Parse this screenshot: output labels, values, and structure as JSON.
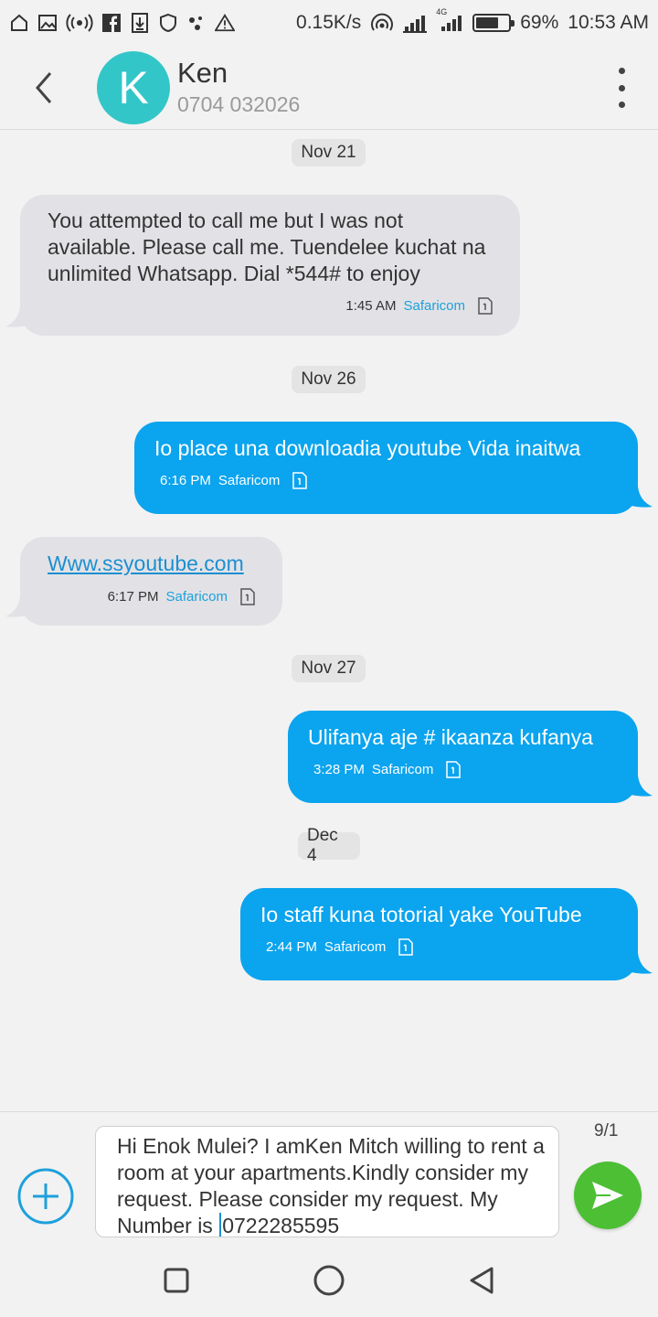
{
  "status_bar": {
    "speed": "0.15K/s",
    "network_badge": "4G",
    "battery": "69%",
    "battery_level": 0.69,
    "time": "10:53 AM",
    "icons": [
      "home-icon",
      "image-icon",
      "radio-icon",
      "facebook-icon",
      "download-icon",
      "shield-icon",
      "dots-icon",
      "warning-icon"
    ]
  },
  "header": {
    "avatar_letter": "K",
    "avatar_color": "#33c6c9",
    "name": "Ken",
    "number": "0704 032026"
  },
  "conversation": {
    "dates": [
      "Nov 21",
      "Nov 26",
      "Nov 27",
      "Dec 4"
    ],
    "messages": [
      {
        "direction": "in",
        "text": "You attempted to call me but I was not available. Please call me. Tuendelee kuchat na unlimited Whatsapp. Dial *544# to enjoy",
        "time": "1:45 AM",
        "carrier": "Safaricom"
      },
      {
        "direction": "out",
        "text": "Io place una downloadia youtube Vida inaitwa",
        "time": "6:16 PM",
        "carrier": "Safaricom"
      },
      {
        "direction": "in",
        "text": "Www.ssyoutube.com",
        "time": "6:17 PM",
        "carrier": "Safaricom"
      },
      {
        "direction": "out",
        "text": "Ulifanya aje # ikaanza kufanya",
        "time": "3:28 PM",
        "carrier": "Safaricom"
      },
      {
        "direction": "out",
        "text": "Io staff kuna totorial yake YouTube",
        "time": "2:44 PM",
        "carrier": "Safaricom"
      }
    ]
  },
  "composer": {
    "draft_before_cursor": "Hi Enok Mulei? I amKen Mitch willing to rent a room at your apartments.Kindly consider my request. Please consider my request.  My Number is ",
    "draft_after_cursor": "0722285595",
    "counter": "9/1",
    "send_color": "#4cbf34"
  },
  "colors": {
    "outgoing_bubble": "#0ba4ee",
    "incoming_bubble": "#e2e2e6",
    "carrier_label": "#1ea0dc"
  }
}
